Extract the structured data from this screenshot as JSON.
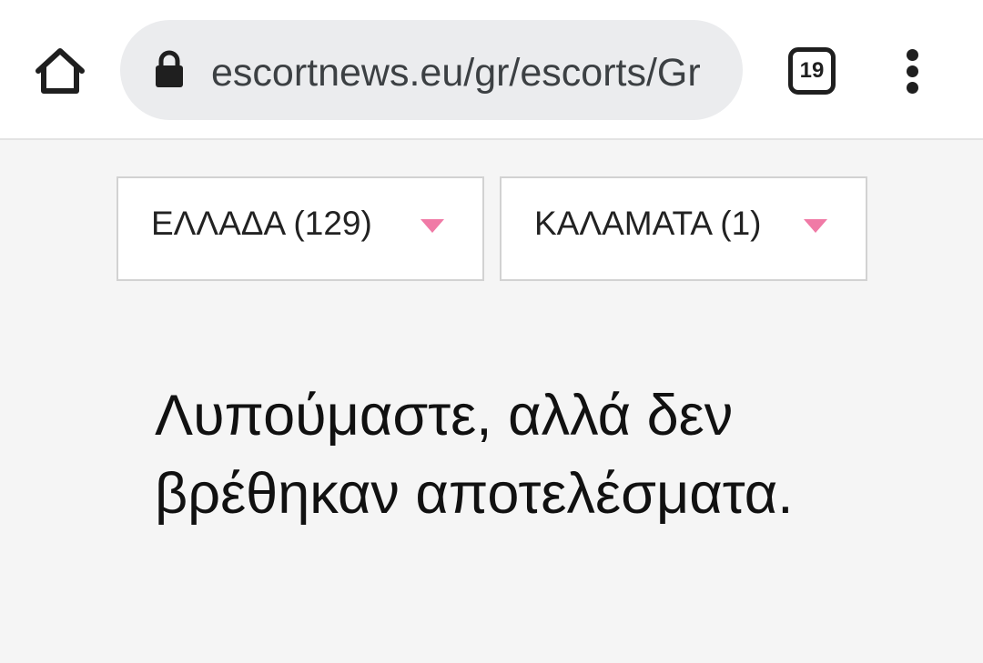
{
  "browser": {
    "url": "escortnews.eu/gr/escorts/Gr",
    "tab_count": "19",
    "icons": [
      "home-icon",
      "lock-icon",
      "tab-switcher-icon",
      "more-vert-icon"
    ]
  },
  "filters": {
    "country": {
      "selected": "ΕΛΛΑΔΑ (129)"
    },
    "city": {
      "selected": "ΚΑΛΑΜΑΤΑ (1)"
    },
    "caret_color": "#f07aa6"
  },
  "message": {
    "no_results": "Λυπούμαστε, αλλά δεν βρέθηκαν αποτελέσματα."
  }
}
